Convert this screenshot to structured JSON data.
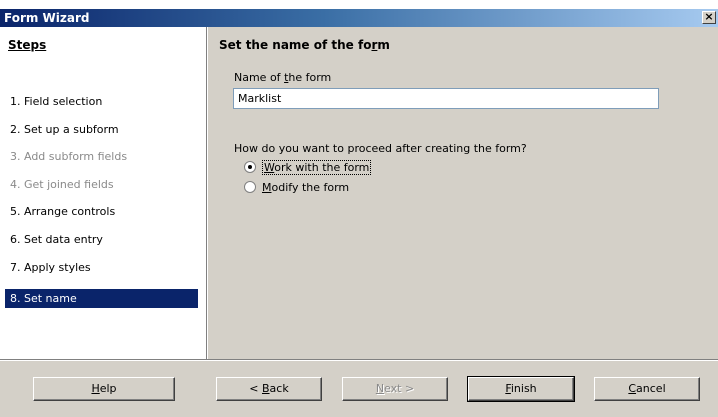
{
  "window": {
    "title": "Form Wizard",
    "close_label": "×"
  },
  "sidebar": {
    "heading": "Steps",
    "steps": [
      {
        "label": "1.  Field selection",
        "state": "normal"
      },
      {
        "label": "2.  Set up a subform",
        "state": "normal"
      },
      {
        "label": "3.  Add subform fields",
        "state": "disabled"
      },
      {
        "label": "4.  Get joined fields",
        "state": "disabled"
      },
      {
        "label": "5.  Arrange controls",
        "state": "normal"
      },
      {
        "label": "6.  Set data entry",
        "state": "normal"
      },
      {
        "label": "7.  Apply styles",
        "state": "normal"
      },
      {
        "label": "8.  Set name",
        "state": "active"
      }
    ]
  },
  "main": {
    "heading_pre": "Set the name of the fo",
    "heading_ul": "r",
    "heading_post": "m",
    "name_label_pre": "Name of ",
    "name_label_ul": "t",
    "name_label_post": "he form",
    "name_value": "Marklist",
    "question": "How do you want to proceed after creating the form?",
    "options": [
      {
        "ul": "W",
        "rest": "ork with the form",
        "checked": true
      },
      {
        "ul": "M",
        "rest": "odify the form",
        "checked": false
      }
    ]
  },
  "buttons": {
    "help": {
      "ul": "H",
      "rest": "elp"
    },
    "back": {
      "pre": "< ",
      "ul": "B",
      "rest": "ack"
    },
    "next": {
      "ul": "N",
      "rest": "ext >"
    },
    "finish": {
      "ul": "F",
      "rest": "inish"
    },
    "cancel": {
      "ul": "C",
      "rest": "ancel"
    }
  }
}
